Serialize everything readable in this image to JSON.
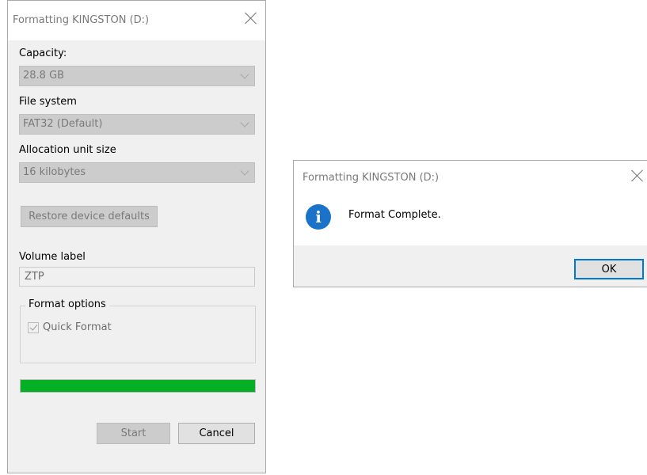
{
  "format_dialog": {
    "title": "Formatting KINGSTON (D:)",
    "capacity": {
      "label": "Capacity:",
      "value": "28.8 GB"
    },
    "file_system": {
      "label": "File system",
      "value": "FAT32 (Default)"
    },
    "allocation_unit_size": {
      "label": "Allocation unit size",
      "value": "16 kilobytes"
    },
    "restore_defaults_label": "Restore device defaults",
    "volume_label": {
      "label": "Volume label",
      "value": "ZTP"
    },
    "format_options": {
      "title": "Format options",
      "quick_format": {
        "label": "Quick Format",
        "checked": true,
        "enabled": false
      }
    },
    "progress": {
      "percent": 100,
      "color": "#06b025"
    },
    "start_label": "Start",
    "cancel_label": "Cancel"
  },
  "message_box": {
    "title": "Formatting KINGSTON (D:)",
    "icon": "info-icon",
    "icon_glyph": "i",
    "message": "Format Complete.",
    "ok_label": "OK"
  },
  "colors": {
    "accent": "#0078d7",
    "progress_green": "#06b025",
    "info_blue": "#1a73c8"
  }
}
